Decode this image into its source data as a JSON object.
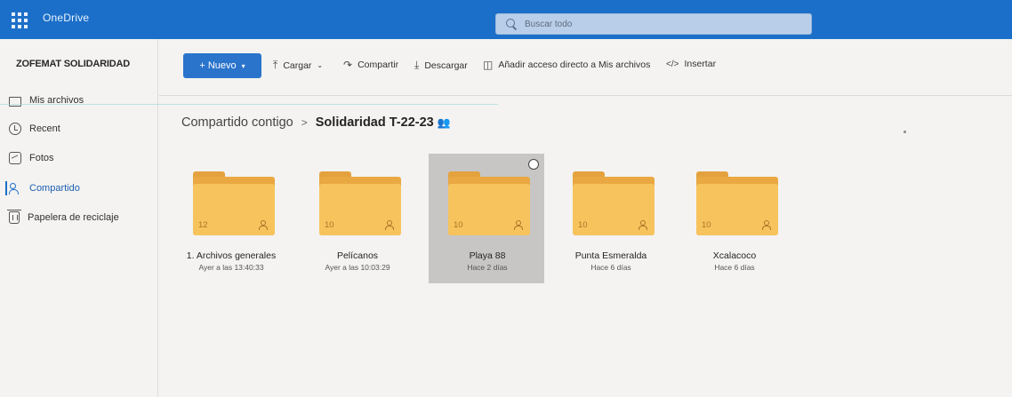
{
  "topbar": {
    "app_name": "OneDrive",
    "search_placeholder": "Buscar todo"
  },
  "sidebar": {
    "org_name": "ZOFEMAT SOLIDARIDAD",
    "items": [
      {
        "label": "Mis archivos",
        "icon": "folder-icon"
      },
      {
        "label": "Recent",
        "icon": "clock-icon"
      },
      {
        "label": "Fotos",
        "icon": "photo-icon"
      },
      {
        "label": "Compartido",
        "icon": "shared-icon",
        "active": true
      },
      {
        "label": "Papelera de reciclaje",
        "icon": "trash-icon"
      }
    ]
  },
  "toolbar": {
    "new_label": "+ Nuevo",
    "upload_label": "Cargar",
    "share_label": "Compartir",
    "download_label": "Descargar",
    "shortcut_label": "Añadir acceso directo a Mis archivos",
    "embed_label": "Insertar"
  },
  "breadcrumb": {
    "parent": "Compartido contigo",
    "current": "Solidaridad T-22-23"
  },
  "folders": [
    {
      "name": "1. Archivos generales",
      "date": "Ayer a las 13:40:33",
      "count": "12",
      "selected": false
    },
    {
      "name": "Pelícanos",
      "date": "Ayer a las 10:03:29",
      "count": "10",
      "selected": false
    },
    {
      "name": "Playa 88",
      "date": "Hace 2 días",
      "count": "10",
      "selected": true
    },
    {
      "name": "Punta Esmeralda",
      "date": "Hace 6 días",
      "count": "10",
      "selected": false
    },
    {
      "name": "Xcalacoco",
      "date": "Hace 6 días",
      "count": "10",
      "selected": false
    }
  ],
  "colors": {
    "brand": "#1b6fc9",
    "folder": "#f7c35c",
    "selection": "#c7c6c5"
  }
}
